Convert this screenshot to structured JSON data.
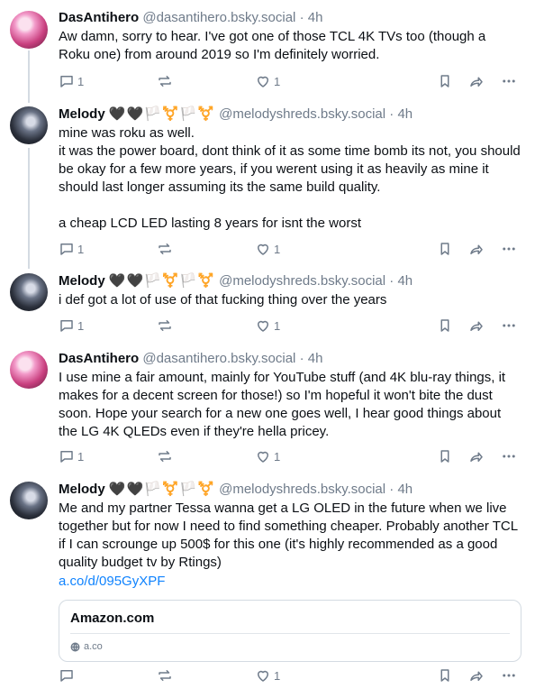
{
  "posts": [
    {
      "name": "DasAntihero",
      "flags": "",
      "handle": "@dasantihero.bsky.social",
      "dot": "·",
      "time": "4h",
      "text": "Aw damn, sorry to hear. I've got one of those TCL 4K TVs too (though a Roku one) from around 2019 so I'm definitely worried.",
      "reply_count": "1",
      "like_count": "1"
    },
    {
      "name": "Melody",
      "flags": "🖤🖤🏳️⚧️🏳️⚧️",
      "handle": "@melodyshreds.bsky.social",
      "dot": "·",
      "time": "4h",
      "text": "mine was roku as well.\nit was the power board, dont think of it as some time bomb its not, you should be okay for a few more years, if you werent using it as heavily as mine it should last longer assuming its the same build quality.\n\na cheap LCD LED lasting 8 years for isnt the worst",
      "reply_count": "1",
      "like_count": "1"
    },
    {
      "name": "Melody",
      "flags": "🖤🖤🏳️⚧️🏳️⚧️",
      "handle": "@melodyshreds.bsky.social",
      "dot": "·",
      "time": "4h",
      "text": "i def got a lot of use of that fucking thing over the years",
      "reply_count": "1",
      "like_count": "1"
    },
    {
      "name": "DasAntihero",
      "flags": "",
      "handle": "@dasantihero.bsky.social",
      "dot": "·",
      "time": "4h",
      "text": "I use mine a fair amount, mainly for YouTube stuff (and 4K blu-ray things, it makes for a decent screen for those!) so I'm hopeful it won't bite the dust soon. Hope your search for a new one goes well, I hear good things about the LG 4K QLEDs even if they're hella pricey.",
      "reply_count": "1",
      "like_count": "1"
    },
    {
      "name": "Melody",
      "flags": "🖤🖤🏳️⚧️🏳️⚧️",
      "handle": "@melodyshreds.bsky.social",
      "dot": "·",
      "time": "4h",
      "text": "Me and my partner Tessa wanna get a LG OLED in the future when we live together but for now I need to find something cheaper. Probably another TCL if I can scrounge up 500$ for this one (it's highly recommended as a good quality budget tv by Rtings)",
      "link": "a.co/d/095GyXPF",
      "card_title": "Amazon.com",
      "card_domain": "a.co",
      "reply_count": "",
      "like_count": "1"
    }
  ],
  "icons": {
    "reply": "reply-icon",
    "repost": "repost-icon",
    "like": "heart-icon",
    "bookmark": "bookmark-icon",
    "share": "share-icon",
    "more": "more-icon",
    "globe": "globe-icon"
  },
  "colors": {
    "link": "#1083fe",
    "muted": "#6f7b8a",
    "thread_line": "#d4dbe2"
  }
}
